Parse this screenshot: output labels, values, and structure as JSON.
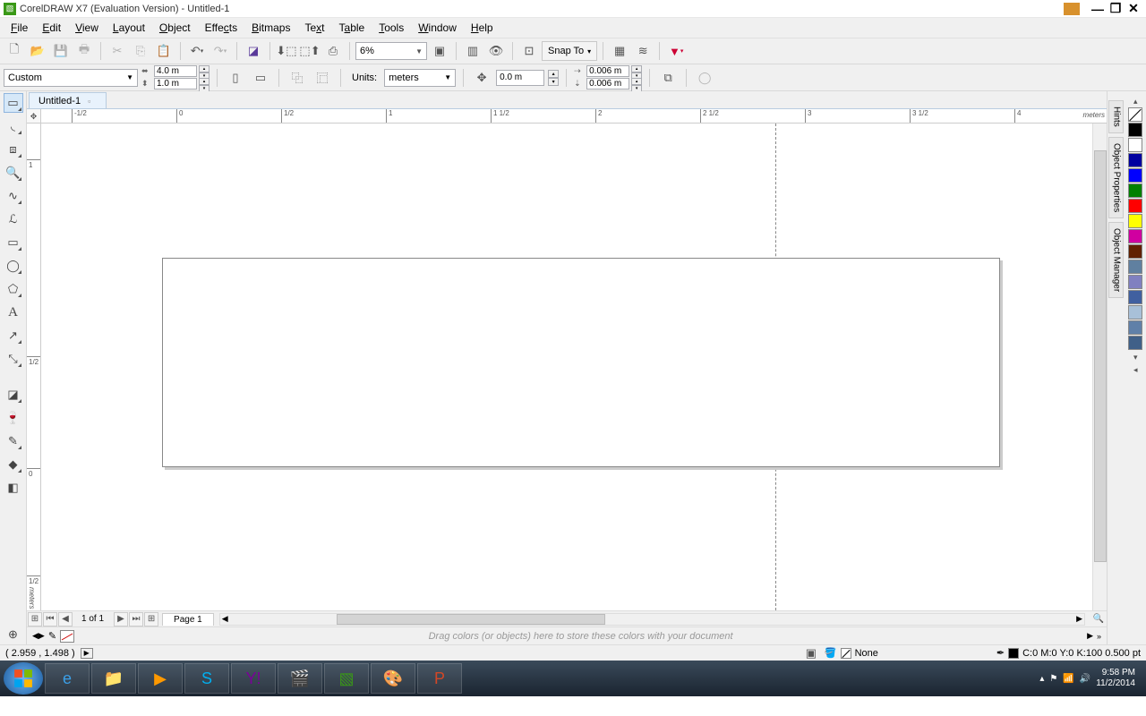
{
  "title": "CorelDRAW X7 (Evaluation Version) - Untitled-1",
  "menu": [
    "File",
    "Edit",
    "View",
    "Layout",
    "Object",
    "Effects",
    "Bitmaps",
    "Text",
    "Table",
    "Tools",
    "Window",
    "Help"
  ],
  "toolbar": {
    "zoom": "6%",
    "snapto": "Snap To"
  },
  "propbar": {
    "pagesize": "Custom",
    "width": "4.0 m",
    "height": "1.0 m",
    "units_label": "Units:",
    "units": "meters",
    "nudge_cross": "0.0 m",
    "dup_x": "0.006 m",
    "dup_y": "0.006 m"
  },
  "document_tab": "Untitled-1",
  "ruler_unit": "meters",
  "ruler_h": [
    "-1/2",
    "0",
    "1/2",
    "1",
    "1 1/2",
    "2",
    "2 1/2",
    "3",
    "3 1/2",
    "4"
  ],
  "ruler_v_top": [
    "1/2",
    "1"
  ],
  "ruler_v_bottom": [
    "0",
    "1/2"
  ],
  "pagebar": {
    "count": "1 of 1",
    "page_label": "Page 1"
  },
  "colordock_msg": "Drag colors (or objects) here to store these colors with your document",
  "status": {
    "coords": "( 2.959 , 1.498 )",
    "fill_label": "None",
    "outline": "C:0 M:0 Y:0 K:100  0.500 pt"
  },
  "dockers": [
    "Hints",
    "Object Properties",
    "Object Manager"
  ],
  "palette": [
    "#000000",
    "#ffffff",
    "#0000a0",
    "#0000ff",
    "#008000",
    "#ff0000",
    "#ffff00",
    "#d000a0",
    "#602000",
    "#6080a0",
    "#8080c0",
    "#4060a0",
    "#a8c0d8",
    "#6080a8",
    "#406088"
  ],
  "tray": {
    "time": "9:58 PM",
    "date": "11/2/2014"
  }
}
